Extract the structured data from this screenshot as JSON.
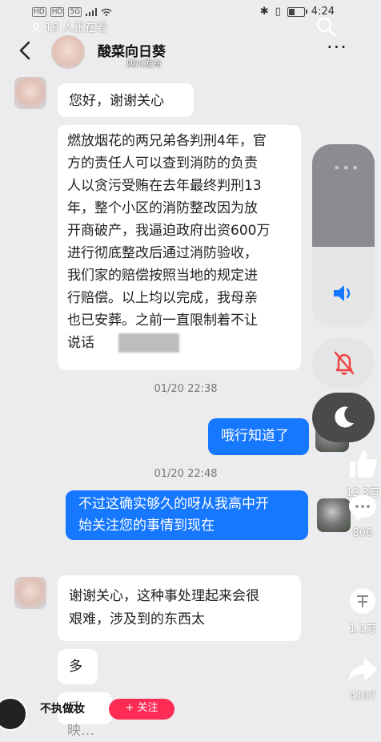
{
  "status_bar": {
    "left_badges": [
      "HD",
      "HD",
      "5G"
    ],
    "time": "4:24"
  },
  "overlay": {
    "viewers": "19 人正在看"
  },
  "chat": {
    "title": "酸菜向日葵",
    "ip_label": "四川发布"
  },
  "messages": {
    "m1": "您好，谢谢关心",
    "m2_lines": [
      "燃放烟花的两兄弟各判刑4年，官",
      "方的责任人可以查到消防的负责",
      "人以贪污受贿在去年最终判刑13",
      "年，整个小区的消防整改因为放",
      "开商破产，我逼迫政府出资600万",
      "进行彻底整改后通过消防验收，",
      "我们家的赔偿按照当地的规定进",
      "行赔偿。以上均以完成，我母亲",
      "也已安葬。之前一直限制着不让",
      "说话"
    ],
    "ts1": "01/20 22:38",
    "m3": "哦行知道了",
    "ts2": "01/20 22:48",
    "m4_lines": [
      "不过这确实够久的呀从我高中开",
      "始关注您的事情到现在"
    ],
    "m5_lines": [
      "谢谢关心，这种事处理起来会很",
      "艰难，涉及到的东西太"
    ],
    "m6": "多",
    "m7": "反映…"
  },
  "side_actions": {
    "likes": "12.3万",
    "comments": "806",
    "favorites": "1.1万",
    "shares": "4107"
  },
  "bottom": {
    "name": "不执做妆",
    "follow": "+ 关注"
  },
  "volume": {
    "level": 0.44
  },
  "colors": {
    "accent_blue": "#1677ff",
    "mute_red": "#ee4444",
    "follow_pink": "#fe2c55"
  }
}
